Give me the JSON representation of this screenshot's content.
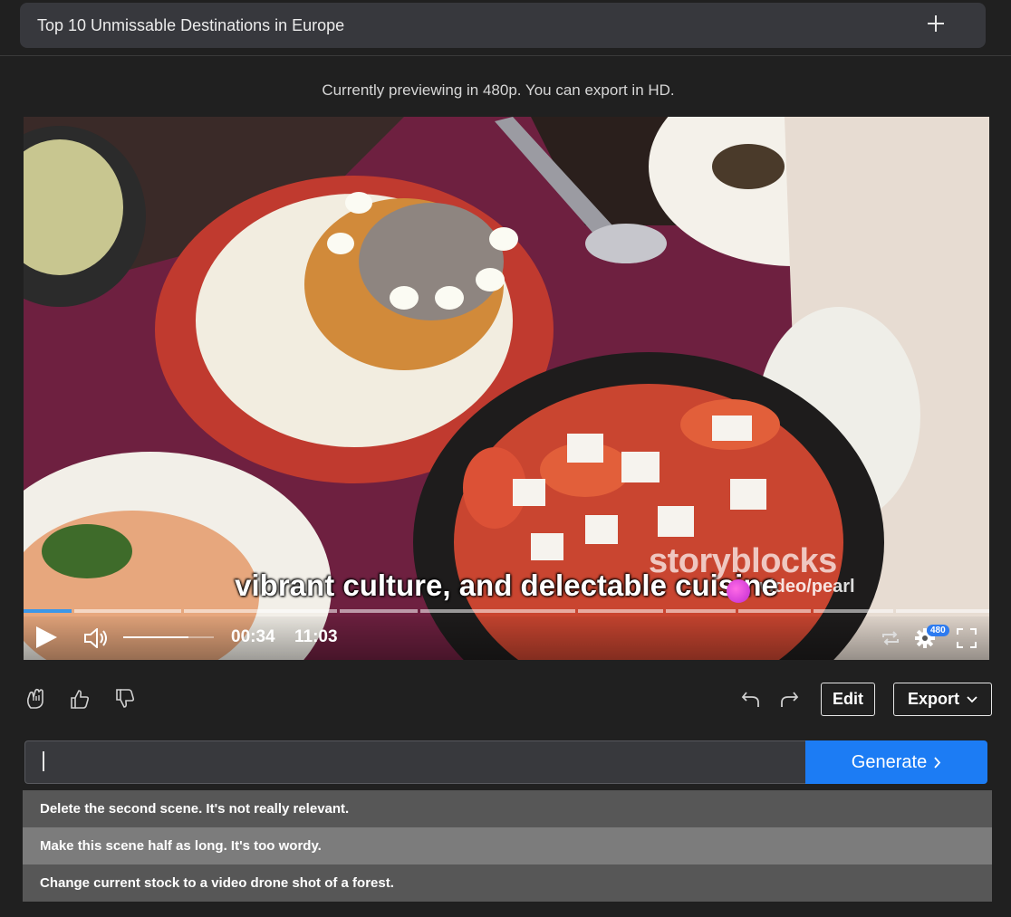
{
  "header": {
    "title": "Top 10 Unmissable Destinations in Europe",
    "add_icon": "plus-icon"
  },
  "preview_notice": "Currently previewing in 480p. You can export in HD.",
  "player": {
    "caption": "vibrant culture, and delectable cuisine",
    "watermark": "storyblocks",
    "watermark_credit": "video/pearl",
    "current_time": "00:34",
    "total_time": "11:03",
    "quality_badge": "480",
    "progress": 0.05,
    "volume": 0.72
  },
  "actions": {
    "edit_label": "Edit",
    "export_label": "Export"
  },
  "prompt": {
    "value": "",
    "generate_label": "Generate"
  },
  "suggestions": [
    "Delete the second scene. It's not really relevant.",
    "Make this scene half as long. It's too wordy.",
    "Change current stock to a video drone shot of a forest."
  ],
  "colors": {
    "accent": "#1c7cf4",
    "background": "#202020"
  }
}
